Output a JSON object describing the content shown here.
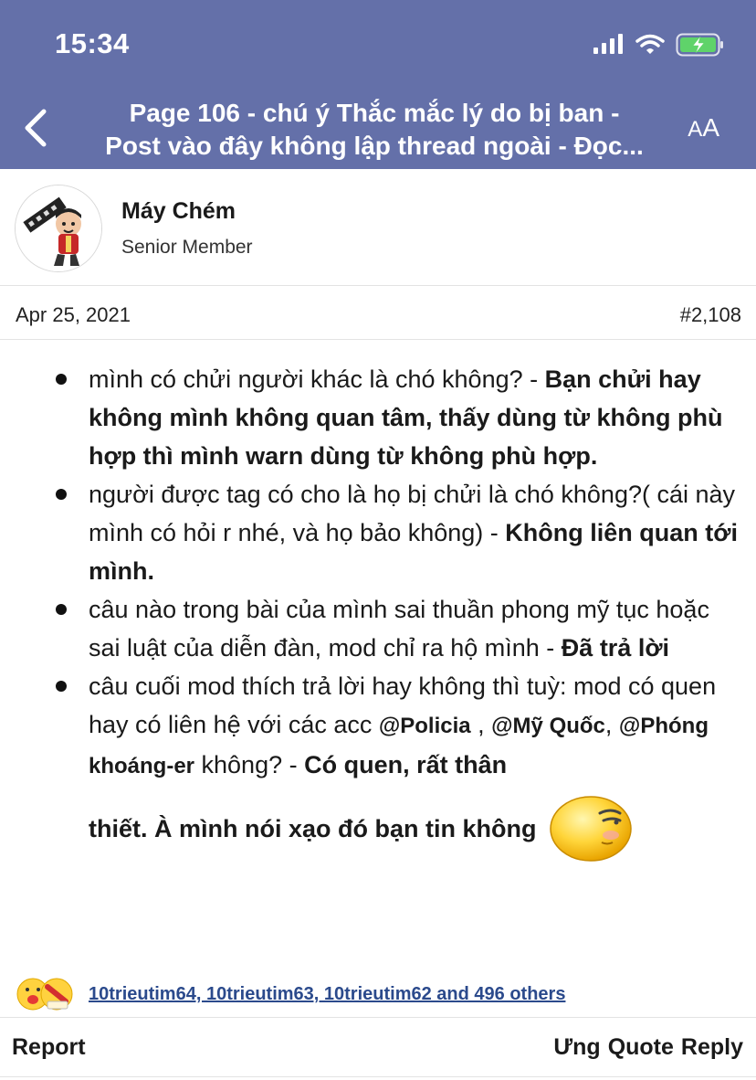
{
  "status_bar": {
    "time": "15:34"
  },
  "nav": {
    "title_line1": "Page 106 - chú ý Thắc mắc lý do bị ban -",
    "title_line2": "Post vào đây không lập thread ngoài - Đọc...",
    "text_size_label_small": "A",
    "text_size_label_large": "A"
  },
  "author": {
    "name": "Máy Chém",
    "title": "Senior Member"
  },
  "post": {
    "date": "Apr 25, 2021",
    "number": "#2,108",
    "items": [
      {
        "text": "mình có chửi người khác là chó không? - ",
        "bold": "Bạn chửi hay không mình không quan tâm, thấy dùng từ không phù hợp thì mình warn dùng từ không phù hợp."
      },
      {
        "text": "người được tag có cho là họ bị chửi là chó không?( cái này mình có hỏi r nhé, và họ bảo không) - ",
        "bold": "Không liên quan tới mình."
      },
      {
        "text": "câu nào trong bài của mình sai thuần phong mỹ tục hoặc sai luật của diễn đàn, mod chỉ ra hộ mình - ",
        "bold": "Đã trả lời"
      },
      {
        "text1": "câu cuối mod thích trả lời hay không thì tuỳ: mod có quen hay có liên hệ với các acc ",
        "mention1": "@Policia",
        "sep1": " , ",
        "mention2": "@Mỹ Quốc",
        "sep2": ", ",
        "mention3": "@Phóng khoáng-er",
        "text2": " không? - ",
        "bold1": "Có quen, rất thân",
        "bold2": "thiết. À mình nói xạo đó bạn tin không"
      }
    ]
  },
  "reactions": {
    "text": "10trieutim64, 10trieutim63, 10trieutim62 and 496 others"
  },
  "actions": {
    "report": "Report",
    "like": "Ưng",
    "quote": "Quote",
    "reply": "Reply"
  },
  "colors": {
    "header_bg": "#6470a9",
    "link": "#2b4a8c"
  }
}
